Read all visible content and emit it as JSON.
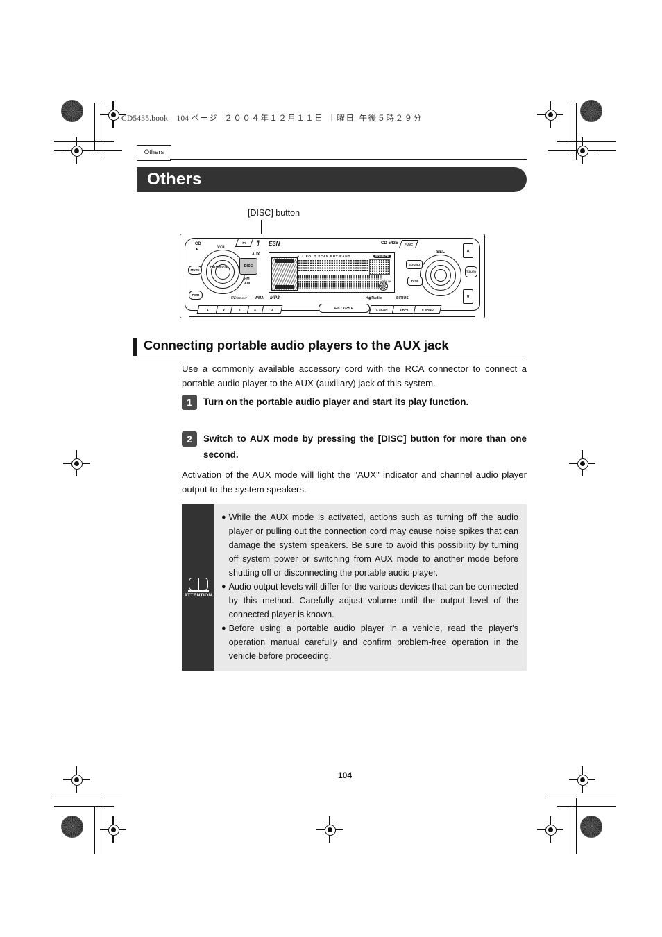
{
  "print_header": {
    "filename": "CD5435.book",
    "page_label": "104",
    "page_word": "ページ",
    "date": "２００４年１２月１１日",
    "weekday": "土曜日",
    "time": "午後５時２９分"
  },
  "chapter_tab": {
    "label": "Others"
  },
  "banner": {
    "title": "Others"
  },
  "callout": {
    "label": "[DISC] button"
  },
  "head_unit": {
    "brand": "ESN",
    "model": "CD 5435",
    "eclipse_badge": "ECLIPSE",
    "left_controls": {
      "cd_eject": "CD",
      "volume": "VOL",
      "power_mute_knob": "PWR/MUTE",
      "mute": "MUTE",
      "power": "PWR",
      "ta": "TA",
      "aux": "AUX",
      "disc": "DISC",
      "fm_am": "FM\nAM"
    },
    "right_controls": {
      "func": "FUNC",
      "sel": "SEL",
      "sound": "SOUND",
      "disp": "DISP",
      "up": "∧",
      "down": "∨",
      "t_auto": "T/AUTO"
    },
    "lcd": {
      "indicators": "ALL FOLD SCAN RPT RAND",
      "source": "SOURCE",
      "disc_in": "DISC IN"
    },
    "format_badges": [
      "5V PRE-OUT",
      "WMA",
      "MP3"
    ],
    "tuner_badges": [
      "HD Radio",
      "SIRIUS"
    ],
    "preset_buttons": [
      {
        "num": "1",
        "fn": ""
      },
      {
        "num": "∨",
        "fn": ""
      },
      {
        "num": "2",
        "fn": ""
      },
      {
        "num": "∧",
        "fn": ""
      },
      {
        "num": "3",
        "fn": ""
      },
      {
        "num": "4",
        "fn": "SCAN"
      },
      {
        "num": "5",
        "fn": "RPT"
      },
      {
        "num": "6",
        "fn": "BAND"
      }
    ]
  },
  "section": {
    "heading": "Connecting portable audio players to the AUX jack",
    "intro": "Use a commonly available accessory cord with the RCA connector to connect a portable audio player to the AUX (auxiliary) jack of this system.",
    "steps": [
      {
        "num": "1",
        "text": "Turn on the portable audio player and start its play function."
      },
      {
        "num": "2",
        "text": "Switch to AUX mode by pressing the [DISC] button for more than one second."
      }
    ],
    "note": "Activation of the AUX mode will light the \"AUX\" indicator and channel audio player output to the system speakers."
  },
  "attention": {
    "caption": "ATTENTION",
    "bullet_glyph": "●",
    "bullets": [
      "While the AUX mode is activated, actions such as turning off the audio player or pulling out the connection cord may cause noise spikes that can damage the system speakers. Be sure to avoid this possibility by turning off system power or switching from AUX mode to another mode before shutting off or disconnecting the portable audio player.",
      "Audio output levels will differ for the various devices that can be connected by this method. Carefully adjust volume until the output level of the connected player is known.",
      "Before using a portable audio player in a vehicle, read the player's operation manual carefully and confirm problem-free operation in the vehicle before proceeding."
    ]
  },
  "footer": {
    "page_number": "104"
  },
  "colors": {
    "banner_bg": "#333333",
    "attention_bg": "#e9e9e9",
    "attention_icon_bg": "#333333",
    "step_badge_bg": "#4a4a4a",
    "rule": "#1a1a1a"
  }
}
